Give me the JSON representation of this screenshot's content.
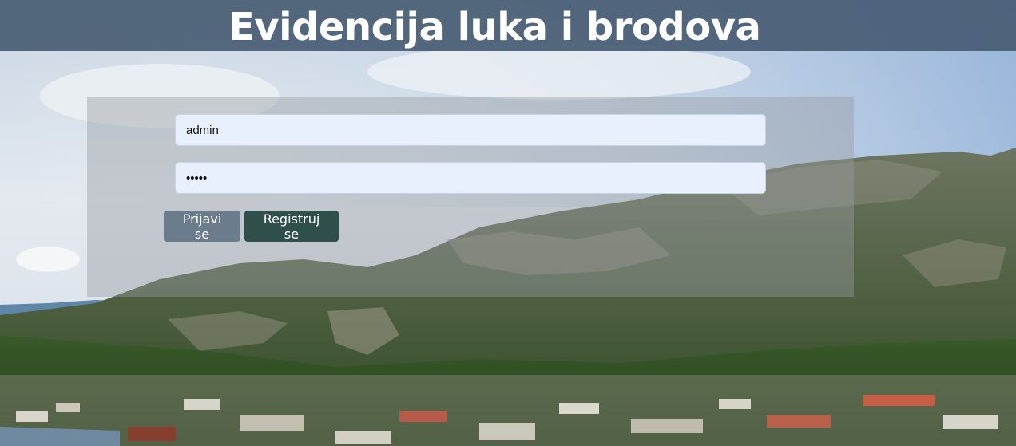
{
  "header": {
    "title": "Evidencija luka i brodova"
  },
  "login_form": {
    "username_value": "admin",
    "password_value": "•••••",
    "login_label": "Prijavi se",
    "register_label": "Registruj se"
  },
  "colors": {
    "header_bg": "#485c73",
    "login_button": "#6b7d8c",
    "register_button": "#2f4f4a",
    "input_bg": "#e8f0fe"
  }
}
